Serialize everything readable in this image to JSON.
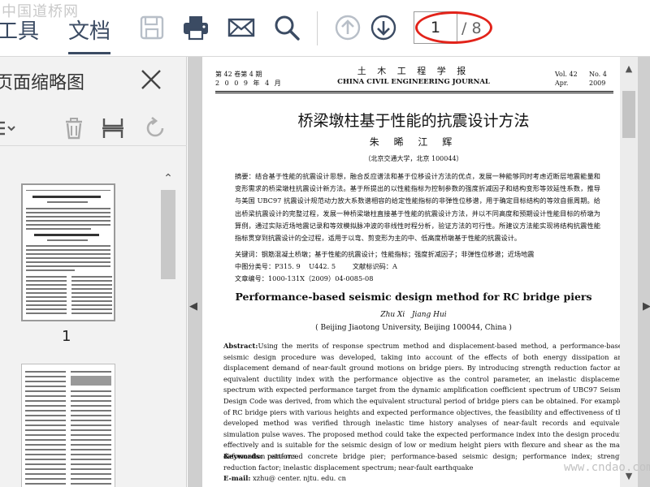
{
  "watermark_top": "中国道桥网",
  "watermark_bottom": "www.cndao.com",
  "toolbar": {
    "tab_tools": "工具",
    "tab_docs": "文档",
    "page_current": "1",
    "page_total": "/ 8"
  },
  "sidebar": {
    "title": "页面缩略图",
    "thumb1_label": "1"
  },
  "paper": {
    "header_vol_cn": "第 42 卷第 4 期",
    "header_date_cn": "2 0 0 9 年 4 月",
    "journal_cn": "土 木 工 程 学 报",
    "journal_en": "CHINA CIVIL ENGINEERING JOURNAL",
    "vol_en": "Vol. 42",
    "no_en": "No. 4",
    "month_en": "Apr.",
    "year_en": "2009",
    "title_cn": "桥梁墩柱基于性能的抗震设计方法",
    "authors_cn": "朱 晞 江 辉",
    "affil_cn": "（北京交通大学，北京 100044）",
    "abstract_cn": "摘要：结合基于性能的抗震设计思想，融合反应谱法和基于位移设计方法的优点，发展一种能够同时考虑近断层地震能量和变形需求的桥梁墩柱抗震设计新方法。基于所提出的以性能指标为控制参数的强度折减因子和结构变形等效延性系数，推导与美国 UBC97 抗震设计规范动力放大系数谱相容的给定性能指标的非弹性位移谱，用于确定目标结构的等效自振周期。给出桥梁抗震设计的完整过程，发展一种桥梁墩柱直接基于性能的抗震设计方法，并以不同高度和预期设计性能目标的桥墩为算例，通过实际近场地震记录和等效模拟脉冲波的非线性时程分析，验证方法的可行性。所建议方法能实现将结构抗震性能指标贯穿到抗震设计的全过程，适用于以弯、剪变形为主的中、低高度桥墩基于性能的抗震设计。",
    "keywords_cn": "关键词：钢筋混凝土桥墩；基于性能的抗震设计；性能指标；强度折减因子；非弹性位移谱；近场地震",
    "clc_cn": "中图分类号：P315. 9    U442. 5        文献标识码：A",
    "article_no_cn": "文章编号：1000-131X（2009）04-0085-08",
    "title_en": "Performance-based seismic design method for RC bridge piers",
    "authors_en": "Zhu Xi   Jiang Hui",
    "affil_en": "( Beijing Jiaotong University, Beijing 100044, China )",
    "abstract_en_lead": "Abstract:",
    "abstract_en": "Using the merits of response spectrum method and displacement-based method, a performance-based seismic design procedure was developed, taking into account of the effects of both energy dissipation and displacement demand of near-fault ground motions on bridge piers. By introducing strength reduction factor and equivalent ductility index with the performance objective as the control parameter, an inelastic displacement spectrum with expected performance target from the dynamic amplification coefficient spectrum of UBC97 Seismic Design Code was derived, from which the equivalent structural period of bridge piers can be obtained. For examples of RC bridge piers with various heights and expected performance objectives, the feasibility and effectiveness of the developed method was verified through inelastic time history analyses of near-fault records and equivalent simulation pulse waves. The proposed method could take the expected performance index into the design procedure effectively and is suitable for the seismic design of low or medium height piers with flexure and shear as the main deformation patterns.",
    "keywords_en_lead": "Keywords:",
    "keywords_en": "reinforced concrete bridge pier; performance-based seismic design; performance index; strength reduction factor; inelastic displacement spectrum; near-fault earthquake",
    "email_en_lead": "E-mail:",
    "email_en": "xzhu@ center. njtu. edu. cn"
  },
  "colors": {
    "toolbar_icon": "#3b4b63",
    "disabled_icon": "#b8bfc8",
    "highlight": "#e2231a"
  }
}
